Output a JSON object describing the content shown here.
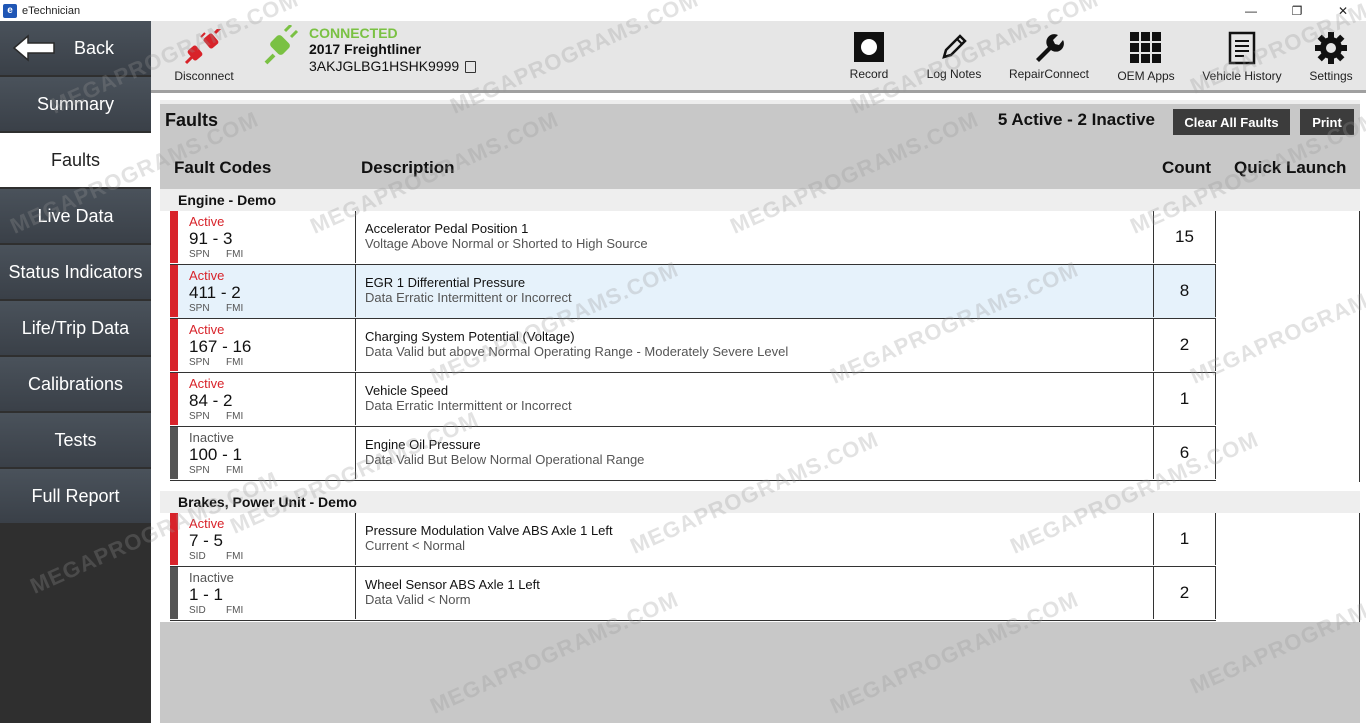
{
  "window": {
    "title": "eTechnician",
    "app_icon_letter": "e",
    "minimize": "—",
    "maximize": "❐",
    "close": "✕"
  },
  "sidebar": {
    "back_label": "Back",
    "items": [
      {
        "label": "Summary"
      },
      {
        "label": "Faults"
      },
      {
        "label": "Live Data"
      },
      {
        "label": "Status Indicators"
      },
      {
        "label": "Life/Trip Data"
      },
      {
        "label": "Calibrations"
      },
      {
        "label": "Tests"
      },
      {
        "label": "Full Report"
      }
    ]
  },
  "toolbar": {
    "disconnect_label": "Disconnect",
    "connection": {
      "status": "CONNECTED",
      "vehicle": "2017 Freightliner",
      "vin": "3AKJGLBG1HSHK9999"
    },
    "tools": [
      {
        "label": "Record",
        "icon": "record-icon"
      },
      {
        "label": "Log Notes",
        "icon": "pencil-icon"
      },
      {
        "label": "RepairConnect",
        "icon": "wrench-icon"
      },
      {
        "label": "OEM Apps",
        "icon": "grid-icon"
      },
      {
        "label": "Vehicle History",
        "icon": "document-icon"
      },
      {
        "label": "Settings",
        "icon": "gear-icon"
      }
    ]
  },
  "faults": {
    "title": "Faults",
    "summary": "5 Active - 2 Inactive",
    "clear_all_label": "Clear All Faults",
    "print_label": "Print",
    "columns": {
      "codes": "Fault Codes",
      "description": "Description",
      "count": "Count",
      "quick_launch": "Quick Launch"
    },
    "groups": [
      {
        "title": "Engine - Demo",
        "rows": [
          {
            "status": "Active",
            "code": "91 - 3",
            "label_a": "SPN",
            "label_b": "FMI",
            "title": "Accelerator Pedal Position 1",
            "detail": "Voltage Above Normal or Shorted to High Source",
            "count": "15"
          },
          {
            "status": "Active",
            "code": "411 - 2",
            "label_a": "SPN",
            "label_b": "FMI",
            "title": "EGR 1 Differential Pressure",
            "detail": "Data Erratic Intermittent or Incorrect",
            "count": "8"
          },
          {
            "status": "Active",
            "code": "167 - 16",
            "label_a": "SPN",
            "label_b": "FMI",
            "title": "Charging System Potential (Voltage)",
            "detail": "Data Valid but above Normal Operating Range - Moderately Severe Level",
            "count": "2"
          },
          {
            "status": "Active",
            "code": "84 - 2",
            "label_a": "SPN",
            "label_b": "FMI",
            "title": "Vehicle Speed",
            "detail": "Data Erratic Intermittent or Incorrect",
            "count": "1"
          },
          {
            "status": "Inactive",
            "code": "100 - 1",
            "label_a": "SPN",
            "label_b": "FMI",
            "title": "Engine Oil Pressure",
            "detail": "Data Valid But Below Normal Operational Range",
            "count": "6"
          }
        ]
      },
      {
        "title": "Brakes, Power Unit - Demo",
        "rows": [
          {
            "status": "Active",
            "code": "7  - 5",
            "label_a": "SID",
            "label_b": "FMI",
            "title": "Pressure Modulation Valve ABS Axle 1 Left",
            "detail": "Current < Normal",
            "count": "1"
          },
          {
            "status": "Inactive",
            "code": "1  - 1",
            "label_a": "SID",
            "label_b": "FMI",
            "title": "Wheel Sensor ABS Axle 1 Left",
            "detail": "Data Valid < Norm",
            "count": "2"
          }
        ]
      }
    ]
  },
  "colors": {
    "active": "#d8232a",
    "inactive": "#555555",
    "connected": "#7ac143",
    "disconnect": "#d8232a"
  },
  "watermark": "MEGAPROGRAMS.COM"
}
